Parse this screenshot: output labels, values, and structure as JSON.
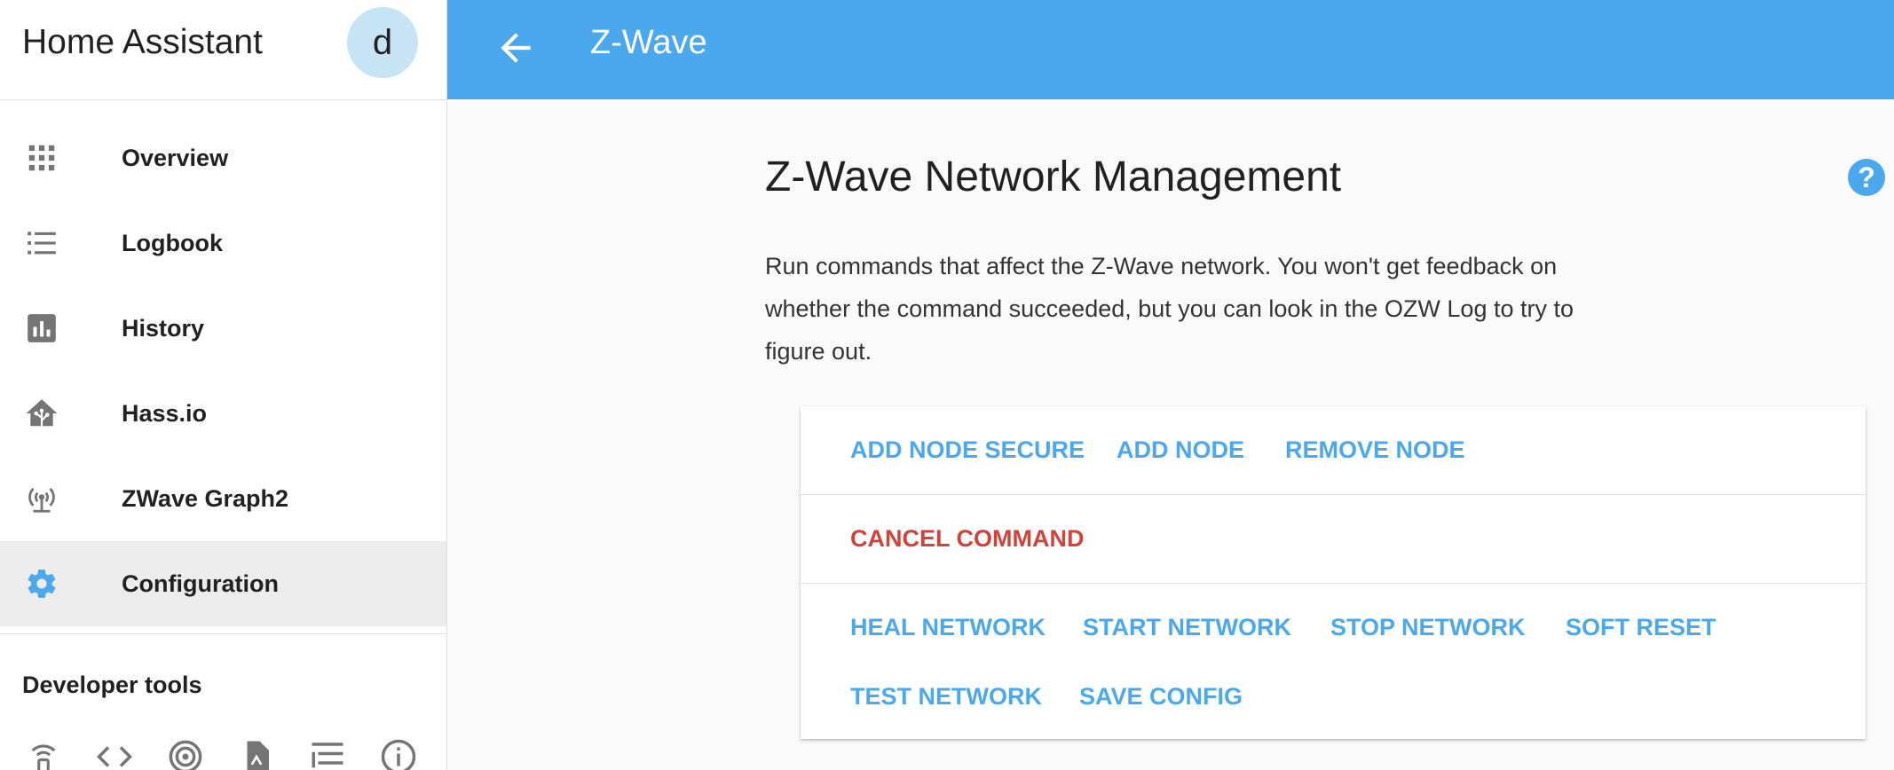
{
  "sidebar": {
    "title": "Home Assistant",
    "avatar_initial": "d",
    "items": [
      {
        "label": "Overview",
        "icon": "grid-icon"
      },
      {
        "label": "Logbook",
        "icon": "list-icon"
      },
      {
        "label": "History",
        "icon": "chart-box-icon"
      },
      {
        "label": "Hass.io",
        "icon": "home-assistant-icon"
      },
      {
        "label": "ZWave Graph2",
        "icon": "antenna-icon"
      },
      {
        "label": "Configuration",
        "icon": "gear-icon",
        "active": true
      }
    ],
    "developer_tools_title": "Developer tools",
    "developer_tools": [
      "remote-icon",
      "code-icon",
      "podcast-icon",
      "file-icon",
      "tree-list-icon",
      "info-icon"
    ]
  },
  "header": {
    "title": "Z-Wave",
    "color": "#4ba8ec"
  },
  "main": {
    "title": "Z-Wave Network Management",
    "description": "Run commands that affect the Z-Wave network. You won't get feedback on whether the command succeeded, but you can look in the OZW Log to try to figure out.",
    "help_icon": "?",
    "buttons_row1": [
      "ADD NODE SECURE",
      "ADD NODE",
      "REMOVE NODE"
    ],
    "buttons_row2": [
      "CANCEL COMMAND"
    ],
    "buttons_row3": [
      "HEAL NETWORK",
      "START NETWORK",
      "STOP NETWORK",
      "SOFT RESET"
    ],
    "buttons_row4": [
      "TEST NETWORK",
      "SAVE CONFIG"
    ]
  },
  "colors": {
    "accent": "#4ba8ec",
    "danger": "#d0433b",
    "icon_gray": "#757575"
  }
}
